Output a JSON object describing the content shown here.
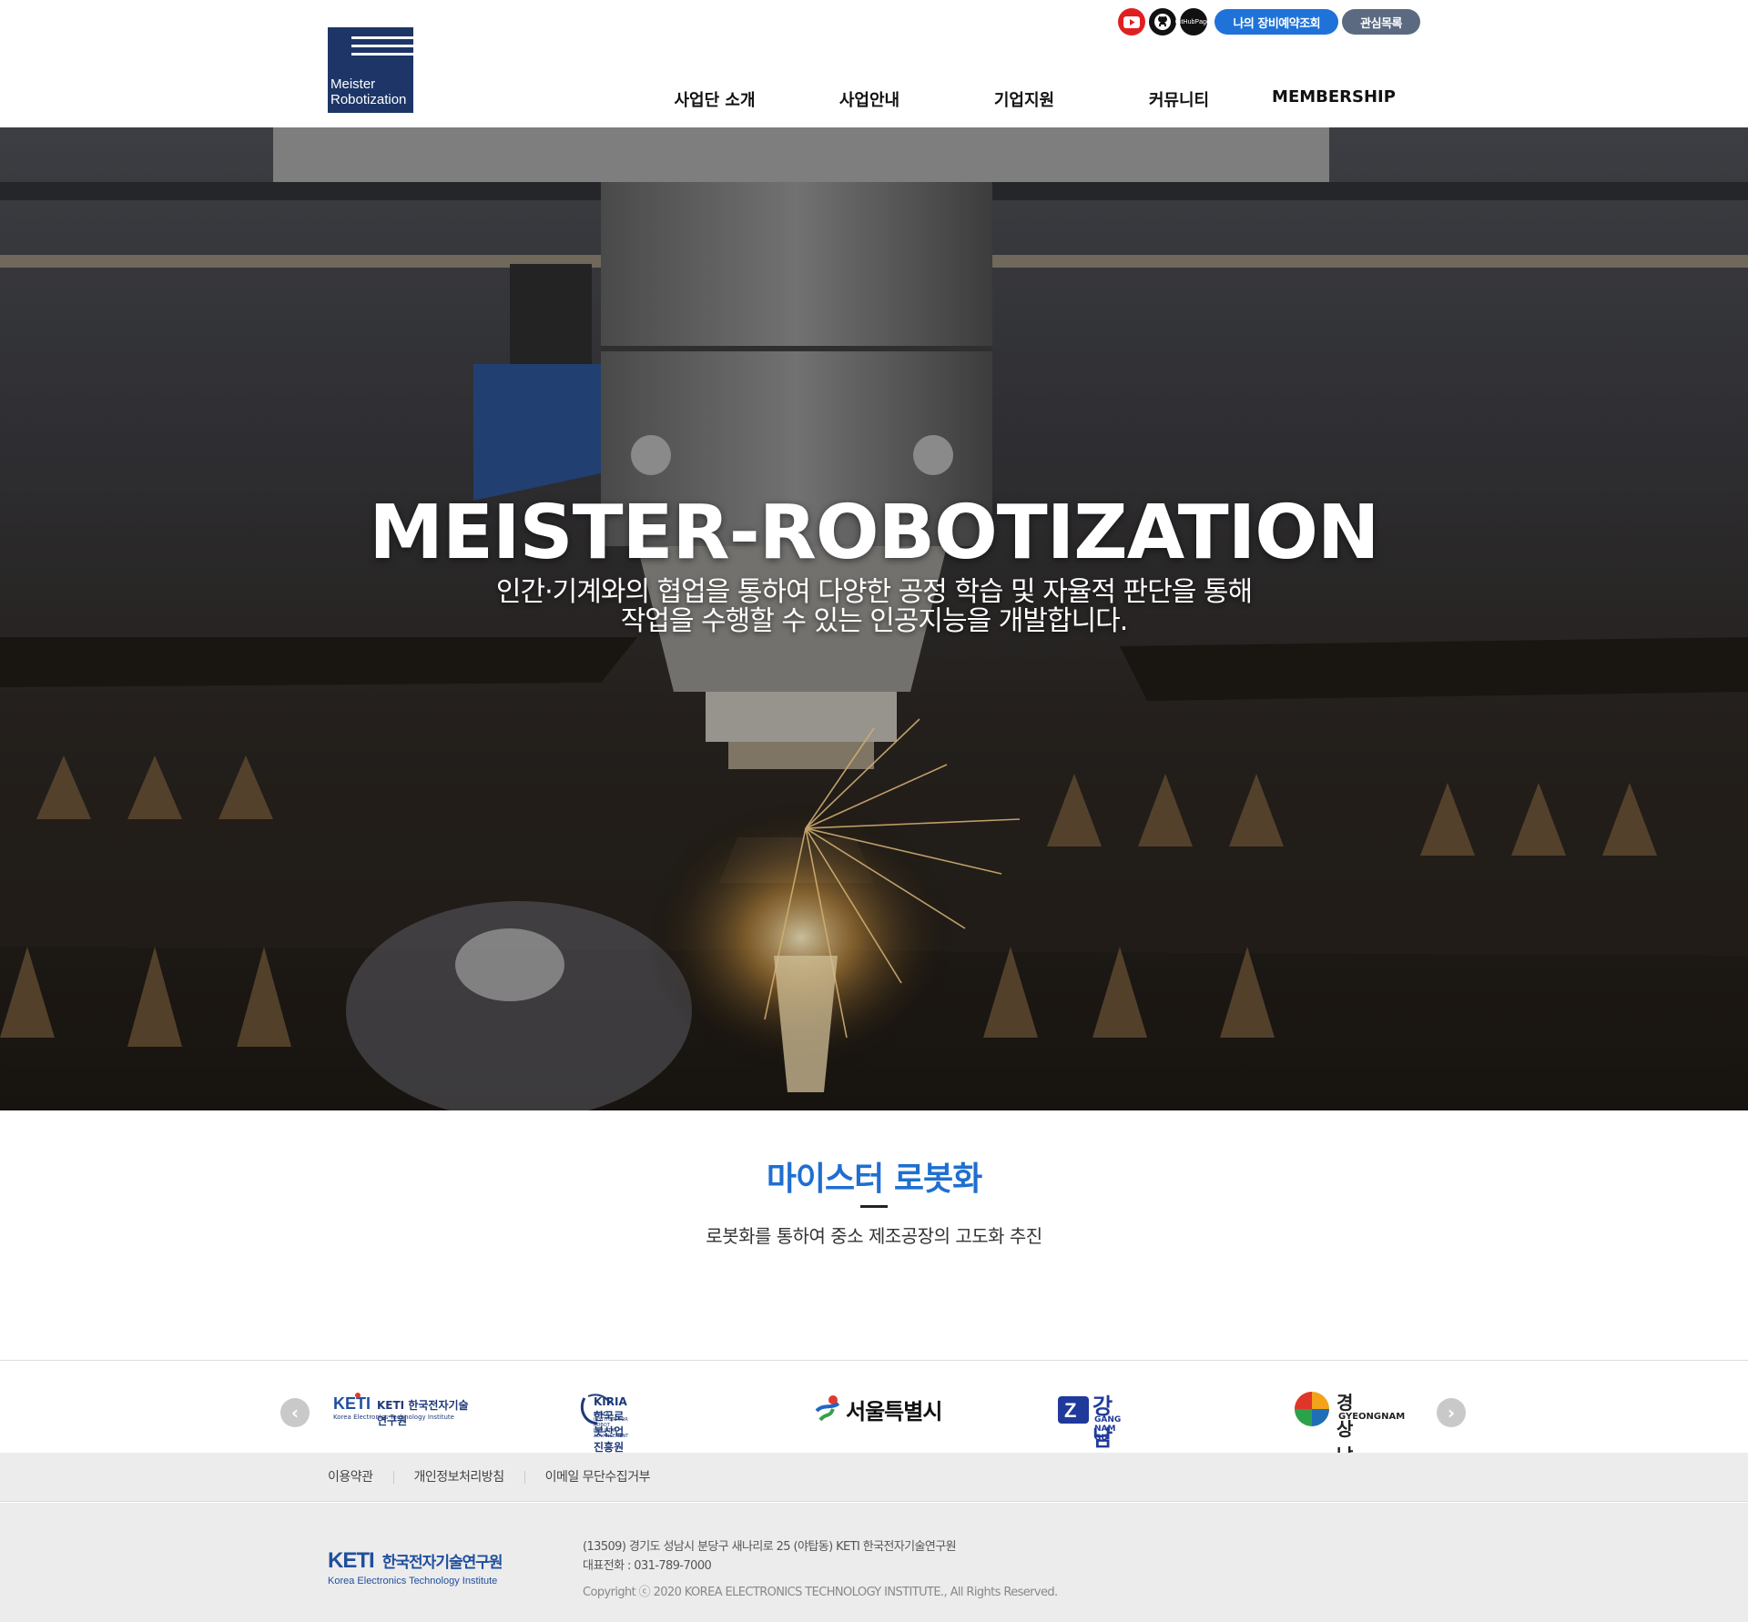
{
  "header": {
    "logo_line1": "Meister",
    "logo_line2": "Robotization",
    "utility": {
      "github_pages_label_1": "GitHub",
      "github_pages_label_2": "Pages",
      "reservation_button": "나의 장비예약조회",
      "wishlist_button": "관심목록"
    },
    "nav": [
      {
        "label": "사업단 소개"
      },
      {
        "label": "사업안내"
      },
      {
        "label": "기업지원"
      },
      {
        "label": "커뮤니티"
      },
      {
        "label": "MEMBERSHIP"
      }
    ]
  },
  "hero": {
    "title": "MEISTER-ROBOTIZATION",
    "subtitle_line1": "인간·기계와의 협업을 통하여 다양한 공정 학습 및 자율적 판단을 통해",
    "subtitle_line2": "작업을 수행할 수 있는 인공지능을 개발합니다."
  },
  "intro": {
    "title": "마이스터 로봇화",
    "subtitle": "로봇화를 통하여 중소 제조공장의 고도화 추진"
  },
  "partners": {
    "items": [
      {
        "name": "KETI 한국전자기술연구원",
        "sub": "Korea Electronics Technology Institute"
      },
      {
        "name": "KIRIA 한국로봇산업진흥원",
        "sub": "KOREA INSTITUTE FOR ROBOT INDUSTRY ADVANCEMENT"
      },
      {
        "name": "서울특별시",
        "sub": ""
      },
      {
        "name": "강남구",
        "sub": "GANG NAM GU"
      },
      {
        "name": "경상남도",
        "sub": "GYEONGNAM"
      }
    ]
  },
  "footer_links": [
    {
      "label": "이용약관"
    },
    {
      "label": "개인정보처리방침"
    },
    {
      "label": "이메일 무단수집거부"
    }
  ],
  "footer": {
    "logo_mark": "KETI",
    "logo_name": "한국전자기술연구원",
    "logo_eng": "Korea Electronics Technology Institute",
    "address": "(13509) 경기도 성남시 분당구 새나리로 25 (야탑동) KETI 한국전자기술연구원",
    "phone": "대표전화 : 031-789-7000",
    "copyright": "Copyright ⓒ 2020 KOREA ELECTRONICS TECHNOLOGY INSTITUTE., All Rights Reserved."
  },
  "colors": {
    "brand_navy": "#1d3667",
    "accent_blue": "#1f72d8",
    "intro_title_blue": "#1f6fd0",
    "secondary_button": "#5b6a80"
  },
  "icons": [
    "youtube-icon",
    "github-icon",
    "github-pages-icon",
    "chevron-left-icon",
    "chevron-right-icon"
  ]
}
